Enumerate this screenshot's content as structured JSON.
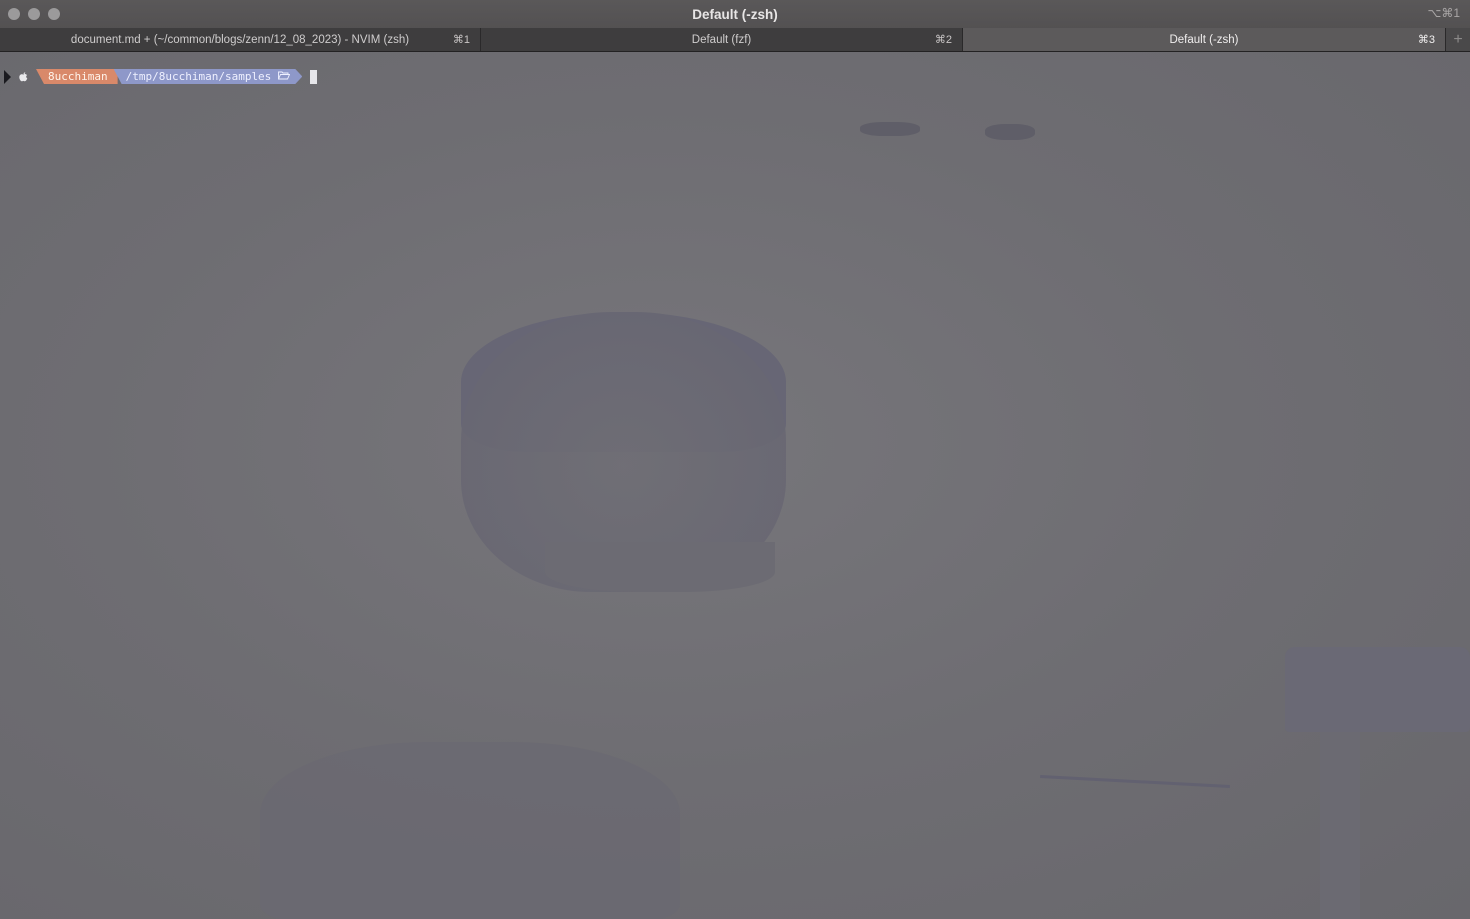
{
  "window": {
    "title": "Default (-zsh)",
    "title_shortcut": "⌥⌘1"
  },
  "tabs": [
    {
      "label": "document.md + (~/common/blogs/zenn/12_08_2023) - NVIM (zsh)",
      "shortcut": "⌘1",
      "active": false
    },
    {
      "label": "Default (fzf)",
      "shortcut": "⌘2",
      "active": false
    },
    {
      "label": "Default (-zsh)",
      "shortcut": "⌘3",
      "active": true
    }
  ],
  "add_tab": "+",
  "prompt": {
    "os_icon": "apple-icon",
    "user": "8ucchiman",
    "path": "/tmp/8ucchiman/samples",
    "folder_icon": "folder-open-icon"
  },
  "colors": {
    "user_segment": "#d9896a",
    "path_segment": "#8e98c9",
    "active_tab": "#5c5a5b"
  }
}
